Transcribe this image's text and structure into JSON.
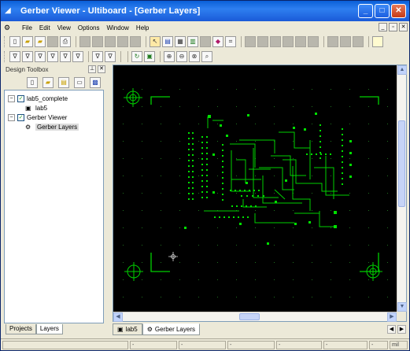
{
  "window": {
    "title": "Gerber Viewer - Ultiboard - [Gerber Layers]",
    "min_glyph": "_",
    "max_glyph": "□",
    "close_glyph": "✕"
  },
  "menubar": {
    "items": [
      "File",
      "Edit",
      "View",
      "Options",
      "Window",
      "Help"
    ],
    "mdi": [
      "_",
      "▫",
      "✕"
    ]
  },
  "toolbox": {
    "title": "Design Toolbox",
    "pin_glyph": "⊥",
    "close_glyph": "✕",
    "tree": [
      {
        "label": "lab5_complete",
        "level": 0,
        "expander": "−",
        "checked": true
      },
      {
        "label": "lab5",
        "level": 1
      },
      {
        "label": "Gerber Viewer",
        "level": 0,
        "expander": "−",
        "checked": true
      },
      {
        "label": "Gerber Layers",
        "level": 1,
        "selected": true
      }
    ],
    "tabs": [
      "Projects",
      "Layers"
    ],
    "active_tab": "Layers"
  },
  "doc_tabs": [
    {
      "label": "lab5",
      "active": false
    },
    {
      "label": "Gerber Layers",
      "active": true
    }
  ],
  "statusbar": {
    "cells": [
      "-",
      "-",
      "-",
      "-",
      "-",
      "-",
      "mil"
    ]
  },
  "colors": {
    "titlebar": "#1a5ad8",
    "canvas_bg": "#000000",
    "trace": "#00e000",
    "grid_dot": "#1f6f1f"
  }
}
